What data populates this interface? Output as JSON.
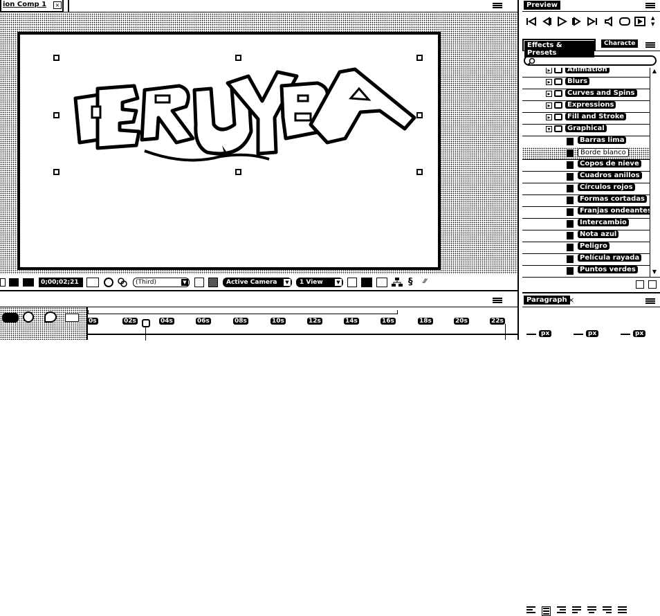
{
  "composition": {
    "tab_label": "ion Comp 1",
    "timecode": "0;00;02;21",
    "resolution": "(Third)",
    "camera": "Active Camera",
    "view": "1 View",
    "artwork_text": "PRUEBA"
  },
  "preview_panel": {
    "title": "Preview"
  },
  "effects_panel": {
    "tab_label": "Effects & Presets",
    "tab2_label": "Characte",
    "search_placeholder": "",
    "categories": [
      {
        "label": "Animation",
        "expanded": false
      },
      {
        "label": "Blurs",
        "expanded": false
      },
      {
        "label": "Curves and Spins",
        "expanded": false
      },
      {
        "label": "Expressions",
        "expanded": false
      },
      {
        "label": "Fill and Stroke",
        "expanded": false
      },
      {
        "label": "Graphical",
        "expanded": true
      }
    ],
    "presets": [
      {
        "label": "Barras lima",
        "selected": false
      },
      {
        "label": "Borde blanco",
        "selected": true
      },
      {
        "label": "Copos de nieve",
        "selected": false
      },
      {
        "label": "Cuadros anillos",
        "selected": false
      },
      {
        "label": "Círculos rojos",
        "selected": false
      },
      {
        "label": "Formas cortadas",
        "selected": false
      },
      {
        "label": "Franjas ondeantes",
        "selected": false
      },
      {
        "label": "Intercambio",
        "selected": false
      },
      {
        "label": "Nota azul",
        "selected": false
      },
      {
        "label": "Peligro",
        "selected": false
      },
      {
        "label": "Película rayada",
        "selected": false
      },
      {
        "label": "Puntos verdes",
        "selected": false
      }
    ]
  },
  "paragraph_panel": {
    "title": "Paragraph",
    "fields": [
      "px",
      "px",
      "px"
    ]
  },
  "timeline": {
    "ticks": [
      "0s",
      "02s",
      "04s",
      "06s",
      "08s",
      "10s",
      "12s",
      "14s",
      "16s",
      "18s",
      "20s",
      "22s"
    ]
  }
}
